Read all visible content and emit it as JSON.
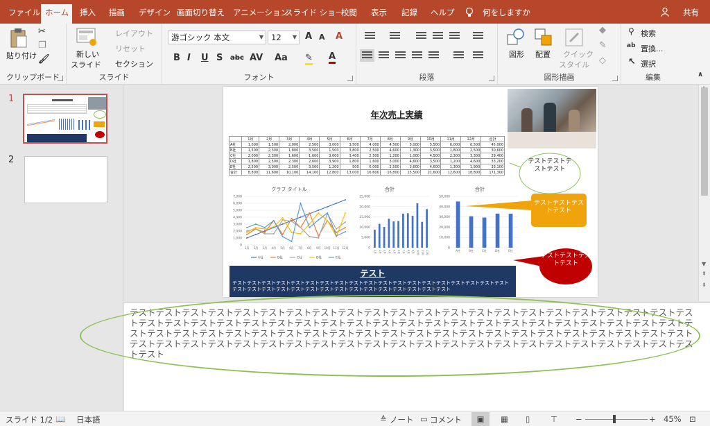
{
  "tabs": [
    "ファイル",
    "ホーム",
    "挿入",
    "描画",
    "デザイン",
    "画面切り替え",
    "アニメーション",
    "スライド ショー",
    "校閲",
    "表示",
    "記録",
    "ヘルプ"
  ],
  "tell_me": "何をしますか",
  "share": "共有",
  "ribbon": {
    "clipboard": {
      "paste": "貼り付け",
      "label": "クリップボード"
    },
    "slides": {
      "new_slide_1": "新しい",
      "new_slide_2": "スライド",
      "layout": "レイアウト",
      "reset": "リセット",
      "section": "セクション",
      "label": "スライド"
    },
    "font": {
      "font_name": "游ゴシック 本文",
      "font_size": "12",
      "label": "フォント"
    },
    "paragraph": {
      "label": "段落"
    },
    "drawing": {
      "shapes": "図形",
      "arrange": "配置",
      "quick_styles_1": "クイック",
      "quick_styles_2": "スタイル",
      "label": "図形描画"
    },
    "editing": {
      "find": "検索",
      "replace": "置換...",
      "select": "選択",
      "label": "編集"
    }
  },
  "thumbnails": [
    "1",
    "2"
  ],
  "slide": {
    "title": "年次売上実績",
    "table": {
      "header": [
        "",
        "1月",
        "2月",
        "3月",
        "4月",
        "5月",
        "6月",
        "7月",
        "8月",
        "9月",
        "10月",
        "11月",
        "12月",
        "合計"
      ],
      "rows": [
        [
          "A社",
          "1,000",
          "1,500",
          "2,000",
          "2,500",
          "3,000",
          "3,500",
          "4,000",
          "4,500",
          "5,000",
          "5,500",
          "6,000",
          "6,500",
          "45,000"
        ],
        [
          "B社",
          "1,500",
          "2,300",
          "1,800",
          "3,500",
          "1,500",
          "3,800",
          "2,500",
          "4,600",
          "1,300",
          "3,500",
          "1,800",
          "2,500",
          "30,600"
        ],
        [
          "C社",
          "2,000",
          "2,300",
          "1,600",
          "1,600",
          "3,600",
          "3,400",
          "2,500",
          "1,200",
          "1,000",
          "4,500",
          "2,300",
          "3,300",
          "29,400"
        ],
        [
          "D社",
          "1,800",
          "2,500",
          "2,300",
          "2,600",
          "3,900",
          "1,800",
          "1,600",
          "3,000",
          "4,600",
          "3,500",
          "1,200",
          "4,600",
          "33,200"
        ],
        [
          "E社",
          "2,500",
          "3,000",
          "2,500",
          "3,500",
          "1,200",
          "500",
          "6,000",
          "2,500",
          "3,600",
          "4,600",
          "1,300",
          "1,900",
          "33,100"
        ],
        [
          "合計",
          "8,800",
          "11,600",
          "10,100",
          "14,100",
          "12,800",
          "13,000",
          "16,600",
          "16,800",
          "15,500",
          "21,600",
          "12,600",
          "18,800",
          "171,300"
        ]
      ]
    },
    "callout_green": "テストテストテストテスト",
    "callout_orange": "テストテストテストテスト",
    "callout_red": "テストテストテストテスト",
    "banner_title": "テスト",
    "banner_text": "テストテストテストテストテストテストテストテストテストテストテストテストテストテストテストテストテストテストテストテストテストテストテストテストテストテストテストテストテストテストテストテストテストテスト"
  },
  "chart_data": [
    {
      "type": "line",
      "title": "グラフ タイトル",
      "categories": [
        "1月",
        "2月",
        "3月",
        "4月",
        "5月",
        "6月",
        "7月",
        "8月",
        "9月",
        "10月",
        "11月",
        "12月"
      ],
      "ylim": [
        0,
        7000
      ],
      "yticks": [
        "7,000",
        "6,000",
        "5,000",
        "4,000",
        "3,000",
        "2,000",
        "1,000",
        "0"
      ],
      "series": [
        {
          "name": "A社",
          "color": "#4472c4",
          "values": [
            1000,
            1500,
            2000,
            2500,
            3000,
            3500,
            4000,
            4500,
            5000,
            5500,
            6000,
            6500
          ]
        },
        {
          "name": "B社",
          "color": "#ed7d31",
          "values": [
            1500,
            2300,
            1800,
            3500,
            1500,
            3800,
            2500,
            4600,
            1300,
            3500,
            1800,
            2500
          ]
        },
        {
          "name": "C社",
          "color": "#a5a5a5",
          "values": [
            2000,
            2300,
            1600,
            1600,
            3600,
            3400,
            2500,
            1200,
            1000,
            4500,
            2300,
            3300
          ]
        },
        {
          "name": "D社",
          "color": "#ffc000",
          "values": [
            1800,
            2500,
            2300,
            2600,
            3900,
            1800,
            1600,
            3000,
            4600,
            3500,
            1200,
            4600
          ]
        },
        {
          "name": "E社",
          "color": "#5b9bd5",
          "values": [
            2500,
            3000,
            2500,
            3500,
            1200,
            500,
            6000,
            2500,
            3600,
            4600,
            1300,
            1900
          ]
        }
      ]
    },
    {
      "type": "bar",
      "title": "合計",
      "categories": [
        "1月",
        "2月",
        "3月",
        "4月",
        "5月",
        "6月",
        "7月",
        "8月",
        "9月",
        "10月",
        "11月",
        "12月"
      ],
      "ylim": [
        0,
        25000
      ],
      "yticks": [
        "25,000",
        "20,000",
        "15,000",
        "10,000",
        "5,000",
        "0"
      ],
      "color": "#4472c4",
      "values": [
        8800,
        11600,
        10100,
        14100,
        12800,
        13000,
        16600,
        16800,
        15500,
        21600,
        12600,
        18800
      ]
    },
    {
      "type": "bar",
      "title": "合計",
      "categories": [
        "A社",
        "B社",
        "C社",
        "D社",
        "E社"
      ],
      "ylim": [
        0,
        50000
      ],
      "yticks": [
        "50,000",
        "40,000",
        "30,000",
        "20,000",
        "10,000",
        "0"
      ],
      "color": "#4472c4",
      "values": [
        45000,
        30600,
        29400,
        33200,
        33100
      ]
    }
  ],
  "notes": "テストテストテストテストテストテストテストテストテストテストテストテストテストテストテストテストテストテストテストテストテストテストテストテストテストテストテストテストテストテストテストテストテストテストテストテストテストテストテストテストテストテストテストテストテストテストテストテストテストテストテストテストテストテストテストテストテストテストテストテストテストテストテストテストテストテストテストテストテストテストテストテストテストテストテストテストテストテストテストテストテストテストテストテストテストテストテストテスト",
  "status": {
    "slide": "スライド 1/2",
    "language": "日本語",
    "notes": "ノート",
    "comments": "コメント",
    "zoom": "45%"
  },
  "colors": {
    "accent": "#b7472a",
    "banner": "#1f3864",
    "callout_orange": "#f0a30a",
    "callout_red": "#c00000",
    "ellipse": "#8cc152"
  }
}
